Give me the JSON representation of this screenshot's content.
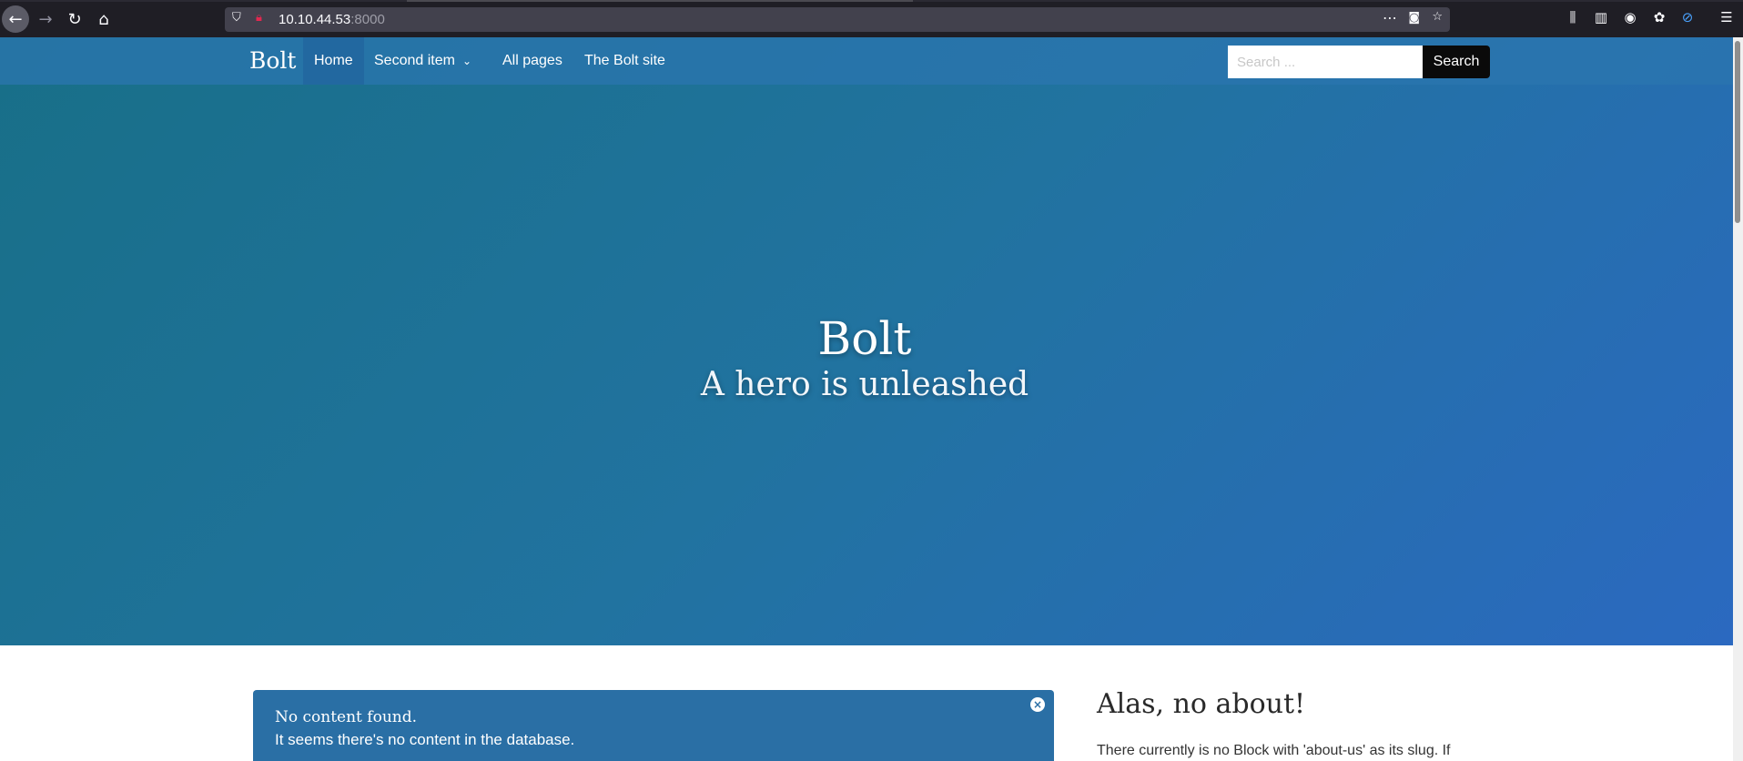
{
  "browser": {
    "url_host": "10.10.44.53",
    "url_port": ":8000"
  },
  "site": {
    "brand": "Bolt",
    "nav": [
      {
        "label": "Home",
        "active": true
      },
      {
        "label": "Second item",
        "has_dropdown": true
      },
      {
        "label": "All pages"
      },
      {
        "label": "The Bolt site"
      }
    ],
    "search": {
      "placeholder": "Search ...",
      "button_label": "Search"
    }
  },
  "hero": {
    "title": "Bolt",
    "subtitle": "A hero is unleashed"
  },
  "notice": {
    "line1": "No content found.",
    "line2": "It seems there's no content in the database.",
    "close_glyph": "×"
  },
  "about": {
    "heading": "Alas, no about!",
    "text": "There currently is no Block with 'about-us' as its slug. If"
  },
  "colors": {
    "hero_gradient_start": "#186f88",
    "hero_gradient_end": "#2b69c0",
    "notice_bg": "#2a6fa5",
    "search_button_bg": "#0a0a0a"
  }
}
